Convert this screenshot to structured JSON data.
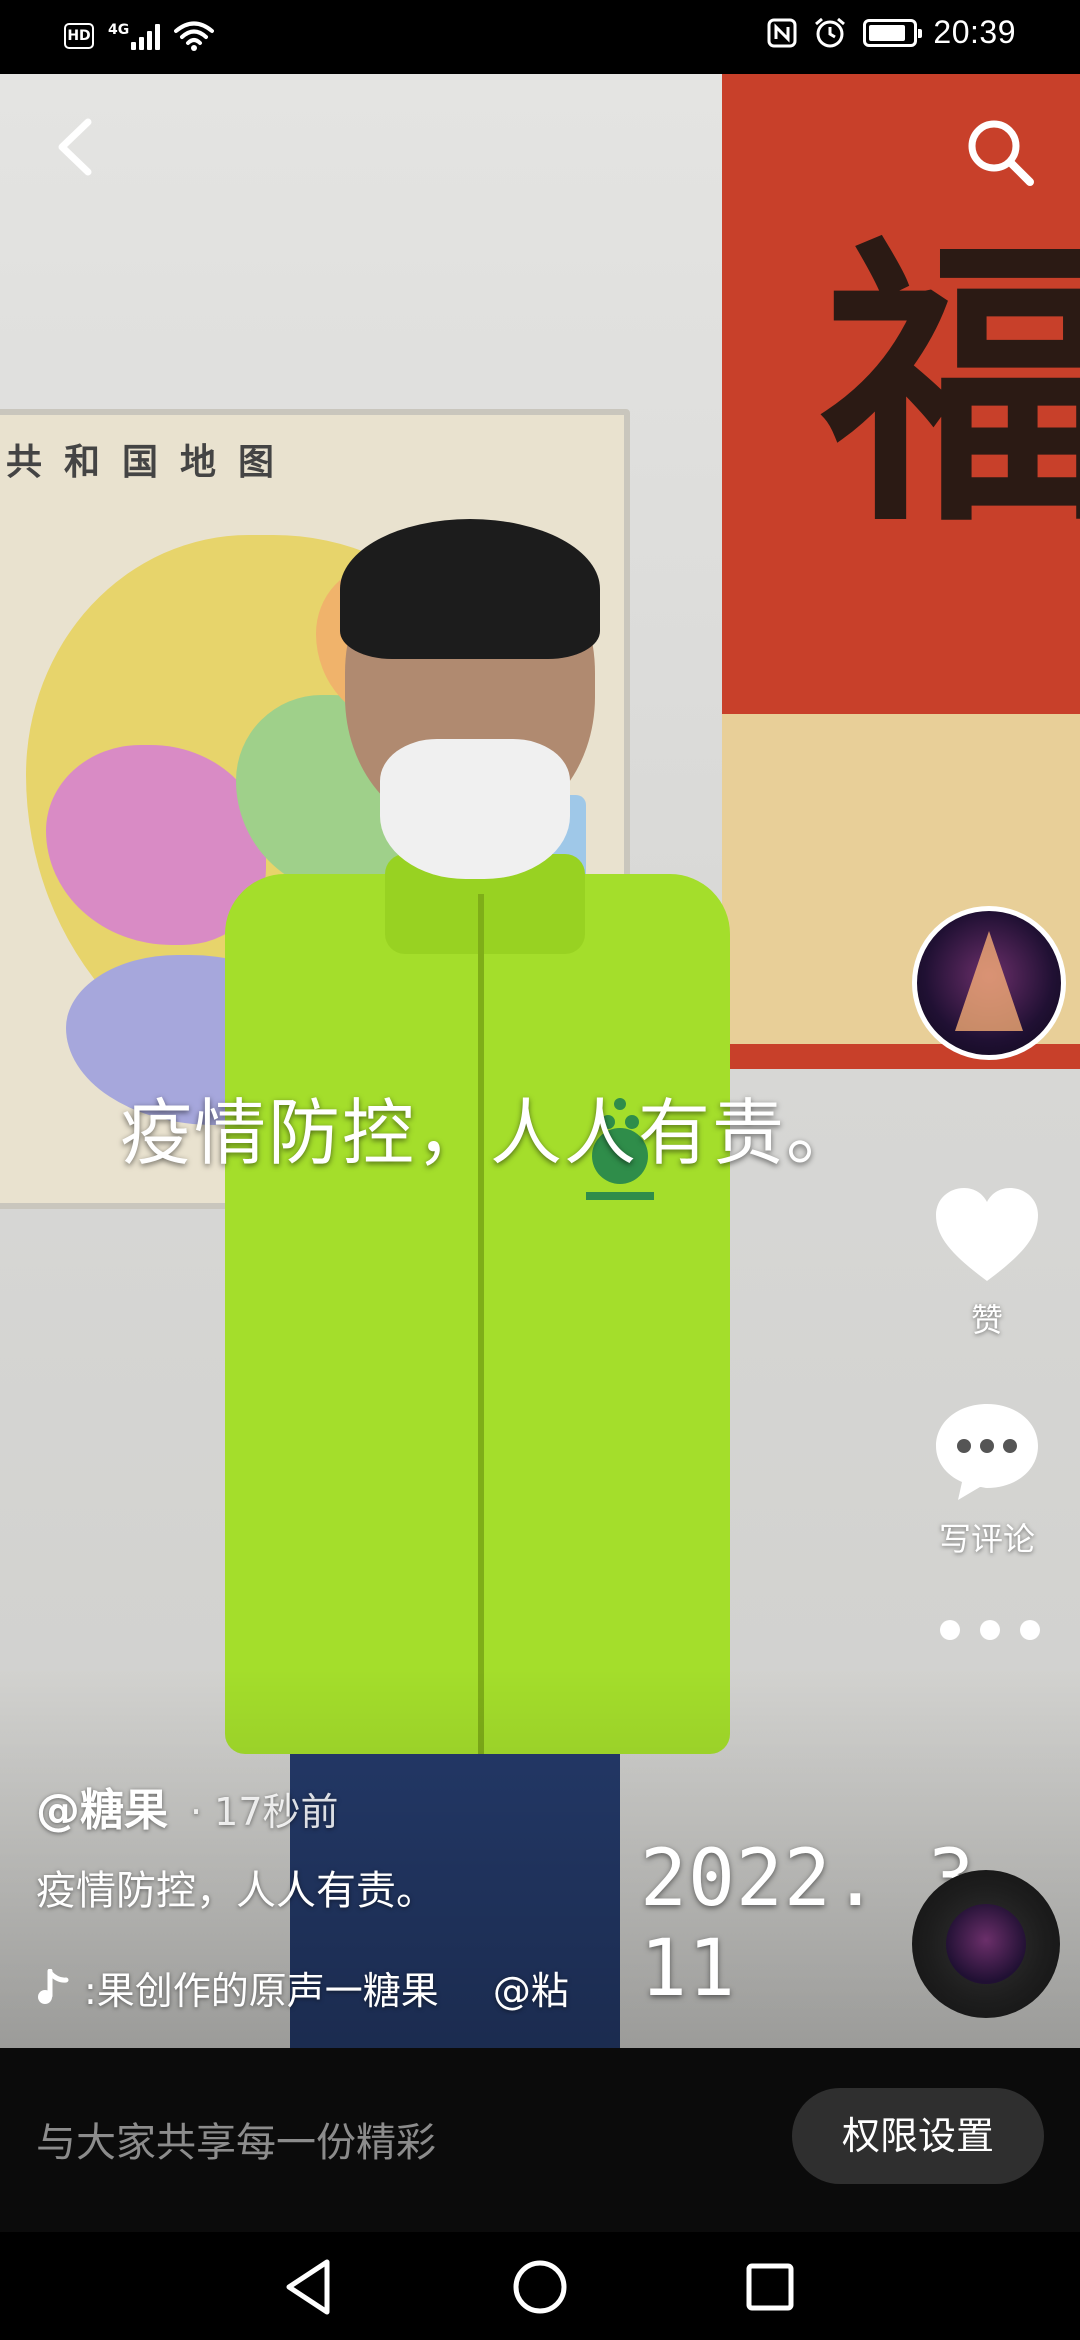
{
  "status_bar": {
    "network": "4G",
    "time": "20:39",
    "battery_level": 0.85,
    "icons": [
      "hd-icon",
      "signal-icon",
      "wifi-icon",
      "nfc-icon",
      "alarm-icon",
      "battery-icon"
    ]
  },
  "video": {
    "overlay_caption": "疫情防控，人人有责。",
    "date_stamp": "2022. 3. 11",
    "map_title": "共和国地图",
    "poster_character": "福"
  },
  "top_bar": {
    "back_icon": "chevron-left-icon",
    "search_icon": "search-icon"
  },
  "side_actions": {
    "like_label": "赞",
    "comment_label": "写评论",
    "more_icon": "more-horizontal-icon"
  },
  "post": {
    "author": "@糖果",
    "time": "· 17秒前",
    "description": "疫情防控，人人有责。",
    "music": ":果创作的原声一糖果",
    "music_mention": "@粘"
  },
  "input_bar": {
    "placeholder": "与大家共享每一份精彩",
    "permission_button": "权限设置"
  },
  "nav_bar": {
    "icons": [
      "back-triangle-icon",
      "home-circle-icon",
      "recents-square-icon"
    ]
  }
}
